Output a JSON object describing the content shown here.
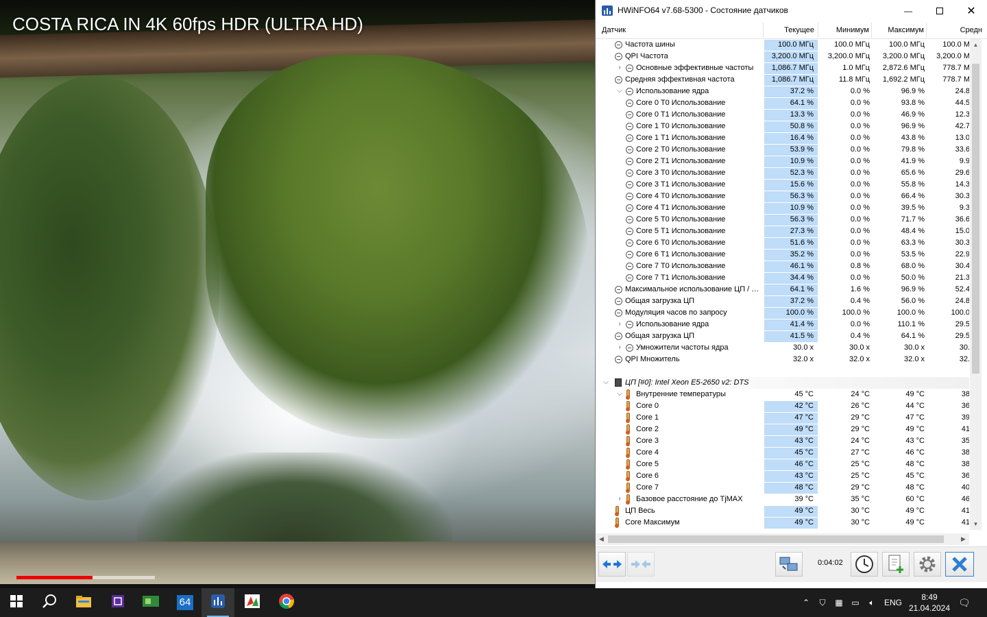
{
  "video": {
    "title": "COSTA RICA IN 4K 60fps HDR (ULTRA HD)",
    "progress_fraction": 0.55
  },
  "window": {
    "title": "HWiNFO64 v7.68-5300 - Состояние датчиков",
    "minimize_glyph": "—",
    "close_glyph": "✕"
  },
  "columns": {
    "sensor": "Датчик",
    "current": "Текущее",
    "min": "Минимум",
    "max": "Максимум",
    "avg": "Средн"
  },
  "rows": [
    {
      "label": "Частота шины",
      "cur": "100.0 МГц",
      "min": "100.0 МГц",
      "max": "100.0 МГц",
      "avg": "100.0 М",
      "indent": 1,
      "icon": "ring-icon",
      "expand": false
    },
    {
      "label": "QPI Частота",
      "cur": "3,200.0 МГц",
      "min": "3,200.0 МГц",
      "max": "3,200.0 МГц",
      "avg": "3,200.0 М",
      "indent": 1,
      "icon": "ring-icon",
      "expand": false
    },
    {
      "label": "Основные эффективные частоты",
      "cur": "1,086.7 МГц",
      "min": "1.0 МГц",
      "max": "2,872.6 МГц",
      "avg": "778.7 М",
      "indent": 2,
      "icon": "ring-icon",
      "expand": "collapsed"
    },
    {
      "label": "Средняя эффективная частота",
      "cur": "1,086.7 МГц",
      "min": "11.8 МГц",
      "max": "1,692.2 МГц",
      "avg": "778.7 М",
      "indent": 1,
      "icon": "ring-icon",
      "expand": false
    },
    {
      "label": "Использование ядра",
      "cur": "37.2 %",
      "min": "0.0 %",
      "max": "96.9 %",
      "avg": "24.8",
      "indent": 2,
      "icon": "ring-icon",
      "expand": "expanded"
    },
    {
      "label": "Core 0 T0 Использование",
      "cur": "64.1 %",
      "min": "0.0 %",
      "max": "93.8 %",
      "avg": "44.5",
      "indent": 3,
      "icon": "ring-icon",
      "expand": false
    },
    {
      "label": "Core 0 T1 Использование",
      "cur": "13.3 %",
      "min": "0.0 %",
      "max": "46.9 %",
      "avg": "12.3",
      "indent": 3,
      "icon": "ring-icon",
      "expand": false
    },
    {
      "label": "Core 1 T0 Использование",
      "cur": "50.8 %",
      "min": "0.0 %",
      "max": "96.9 %",
      "avg": "42.7",
      "indent": 3,
      "icon": "ring-icon",
      "expand": false
    },
    {
      "label": "Core 1 T1 Использование",
      "cur": "16.4 %",
      "min": "0.0 %",
      "max": "43.8 %",
      "avg": "13.0",
      "indent": 3,
      "icon": "ring-icon",
      "expand": false
    },
    {
      "label": "Core 2 T0 Использование",
      "cur": "53.9 %",
      "min": "0.0 %",
      "max": "79.8 %",
      "avg": "33.6",
      "indent": 3,
      "icon": "ring-icon",
      "expand": false
    },
    {
      "label": "Core 2 T1 Использование",
      "cur": "10.9 %",
      "min": "0.0 %",
      "max": "41.9 %",
      "avg": "9.9",
      "indent": 3,
      "icon": "ring-icon",
      "expand": false
    },
    {
      "label": "Core 3 T0 Использование",
      "cur": "52.3 %",
      "min": "0.0 %",
      "max": "65.6 %",
      "avg": "29.6",
      "indent": 3,
      "icon": "ring-icon",
      "expand": false
    },
    {
      "label": "Core 3 T1 Использование",
      "cur": "15.6 %",
      "min": "0.0 %",
      "max": "55.8 %",
      "avg": "14.3",
      "indent": 3,
      "icon": "ring-icon",
      "expand": false
    },
    {
      "label": "Core 4 T0 Использование",
      "cur": "56.3 %",
      "min": "0.0 %",
      "max": "66.4 %",
      "avg": "30.3",
      "indent": 3,
      "icon": "ring-icon",
      "expand": false
    },
    {
      "label": "Core 4 T1 Использование",
      "cur": "10.9 %",
      "min": "0.0 %",
      "max": "39.5 %",
      "avg": "9.3",
      "indent": 3,
      "icon": "ring-icon",
      "expand": false
    },
    {
      "label": "Core 5 T0 Использование",
      "cur": "56.3 %",
      "min": "0.0 %",
      "max": "71.7 %",
      "avg": "36.6",
      "indent": 3,
      "icon": "ring-icon",
      "expand": false
    },
    {
      "label": "Core 5 T1 Использование",
      "cur": "27.3 %",
      "min": "0.0 %",
      "max": "48.4 %",
      "avg": "15.0",
      "indent": 3,
      "icon": "ring-icon",
      "expand": false
    },
    {
      "label": "Core 6 T0 Использование",
      "cur": "51.6 %",
      "min": "0.0 %",
      "max": "63.3 %",
      "avg": "30.3",
      "indent": 3,
      "icon": "ring-icon",
      "expand": false
    },
    {
      "label": "Core 6 T1 Использование",
      "cur": "35.2 %",
      "min": "0.0 %",
      "max": "53.5 %",
      "avg": "22.9",
      "indent": 3,
      "icon": "ring-icon",
      "expand": false
    },
    {
      "label": "Core 7 T0 Использование",
      "cur": "46.1 %",
      "min": "0.8 %",
      "max": "68.0 %",
      "avg": "30.4",
      "indent": 3,
      "icon": "ring-icon",
      "expand": false
    },
    {
      "label": "Core 7 T1 Использование",
      "cur": "34.4 %",
      "min": "0.0 %",
      "max": "50.0 %",
      "avg": "21.3",
      "indent": 3,
      "icon": "ring-icon",
      "expand": false
    },
    {
      "label": "Максимальное использование ЦП / п...",
      "cur": "64.1 %",
      "min": "1.6 %",
      "max": "96.9 %",
      "avg": "52.4",
      "indent": 1,
      "icon": "ring-icon",
      "expand": false
    },
    {
      "label": "Общая загрузка ЦП",
      "cur": "37.2 %",
      "min": "0.4 %",
      "max": "56.0 %",
      "avg": "24.8",
      "indent": 1,
      "icon": "ring-icon",
      "expand": false
    },
    {
      "label": "Модуляция часов по запросу",
      "cur": "100.0 %",
      "min": "100.0 %",
      "max": "100.0 %",
      "avg": "100.0",
      "indent": 1,
      "icon": "ring-icon",
      "expand": false
    },
    {
      "label": "Использование ядра",
      "cur": "41.4 %",
      "min": "0.0 %",
      "max": "110.1 %",
      "avg": "29.5",
      "indent": 2,
      "icon": "ring-icon",
      "expand": "collapsed"
    },
    {
      "label": "Общая загрузка ЦП",
      "cur": "41.5 %",
      "min": "0.4 %",
      "max": "64.1 %",
      "avg": "29.5",
      "indent": 1,
      "icon": "ring-icon",
      "expand": false
    },
    {
      "label": "Умножители частоты ядра",
      "cur": "30.0 x",
      "min": "30.0 x",
      "max": "30.0 x",
      "avg": "30.",
      "indent": 2,
      "icon": "ring-icon",
      "expand": "collapsed",
      "plain": true
    },
    {
      "label": "QPI Множитель",
      "cur": "32.0 x",
      "min": "32.0 x",
      "max": "32.0 x",
      "avg": "32.",
      "indent": 1,
      "icon": "ring-icon",
      "expand": false,
      "plain": true
    },
    {
      "label": "",
      "cur": "",
      "min": "",
      "max": "",
      "avg": "",
      "indent": 0,
      "icon": "none",
      "expand": false,
      "blank": true
    },
    {
      "label": "ЦП [#0]: Intel Xeon E5-2650 v2: DTS",
      "cur": "",
      "min": "",
      "max": "",
      "avg": "",
      "indent": 0,
      "icon": "chip-icon",
      "expand": "expanded",
      "section": true
    },
    {
      "label": "Внутренние температуры",
      "cur": "45 °C",
      "min": "24 °C",
      "max": "49 °C",
      "avg": "38",
      "indent": 2,
      "icon": "thermometer-icon",
      "expand": "expanded",
      "plain": true
    },
    {
      "label": "Core 0",
      "cur": "42 °C",
      "min": "26 °C",
      "max": "44 °C",
      "avg": "36",
      "indent": 3,
      "icon": "thermometer-icon",
      "expand": false
    },
    {
      "label": "Core 1",
      "cur": "47 °C",
      "min": "29 °C",
      "max": "47 °C",
      "avg": "39",
      "indent": 3,
      "icon": "thermometer-icon",
      "expand": false
    },
    {
      "label": "Core 2",
      "cur": "49 °C",
      "min": "29 °C",
      "max": "49 °C",
      "avg": "41",
      "indent": 3,
      "icon": "thermometer-icon",
      "expand": false
    },
    {
      "label": "Core 3",
      "cur": "43 °C",
      "min": "24 °C",
      "max": "43 °C",
      "avg": "35",
      "indent": 3,
      "icon": "thermometer-icon",
      "expand": false
    },
    {
      "label": "Core 4",
      "cur": "45 °C",
      "min": "27 °C",
      "max": "46 °C",
      "avg": "38",
      "indent": 3,
      "icon": "thermometer-icon",
      "expand": false
    },
    {
      "label": "Core 5",
      "cur": "46 °C",
      "min": "25 °C",
      "max": "48 °C",
      "avg": "38",
      "indent": 3,
      "icon": "thermometer-icon",
      "expand": false
    },
    {
      "label": "Core 6",
      "cur": "43 °C",
      "min": "25 °C",
      "max": "45 °C",
      "avg": "36",
      "indent": 3,
      "icon": "thermometer-icon",
      "expand": false
    },
    {
      "label": "Core 7",
      "cur": "48 °C",
      "min": "29 °C",
      "max": "48 °C",
      "avg": "40",
      "indent": 3,
      "icon": "thermometer-icon",
      "expand": false
    },
    {
      "label": "Базовое расстояние до TjMAX",
      "cur": "39 °C",
      "min": "35 °C",
      "max": "60 °C",
      "avg": "46",
      "indent": 2,
      "icon": "thermometer-icon",
      "expand": "collapsed",
      "plain": true
    },
    {
      "label": "ЦП Весь",
      "cur": "49 °C",
      "min": "30 °C",
      "max": "49 °C",
      "avg": "41",
      "indent": 1,
      "icon": "thermometer-icon",
      "expand": false
    },
    {
      "label": "Core Максимум",
      "cur": "49 °C",
      "min": "30 °C",
      "max": "49 °C",
      "avg": "41",
      "indent": 1,
      "icon": "thermometer-icon",
      "expand": false
    }
  ],
  "toolbar": {
    "elapsed": "0:04:02"
  },
  "taskbar": {
    "apps": [
      {
        "name": "start-icon"
      },
      {
        "name": "search-icon"
      },
      {
        "name": "file-explorer-icon"
      },
      {
        "name": "cpu-z-icon"
      },
      {
        "name": "gpu-z-icon"
      },
      {
        "name": "aida64-icon",
        "text": "64"
      },
      {
        "name": "hwinfo-icon",
        "active": true
      },
      {
        "name": "media-app-icon"
      },
      {
        "name": "chrome-icon"
      }
    ],
    "lang": "ENG",
    "time": "8:49",
    "date": "21.04.2024"
  }
}
